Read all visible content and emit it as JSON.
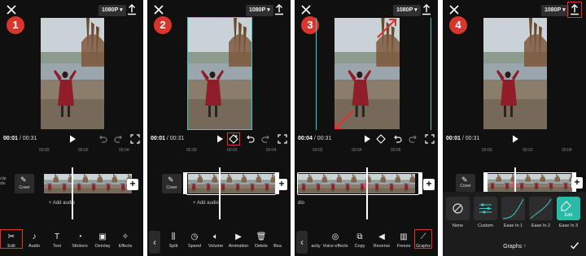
{
  "panels": [
    {
      "step": "1",
      "resolution": "1080P",
      "time_current": "00:01",
      "time_total": "/ 00:31",
      "ruler": [
        "00:00",
        "00:02",
        "00:04"
      ],
      "clip_sound_line1": "clip",
      "clip_sound_line2": "dio",
      "cover_label": "Cover",
      "add_audio": "+ Add audio",
      "tools": [
        {
          "icon": "scissors-icon",
          "label": "Edit",
          "boxed": true
        },
        {
          "icon": "music-note-icon",
          "label": "Audio"
        },
        {
          "icon": "text-icon",
          "label": "Text"
        },
        {
          "icon": "sticker-icon",
          "label": "Stickers"
        },
        {
          "icon": "overlay-icon",
          "label": "Overlay"
        },
        {
          "icon": "effects-icon",
          "label": "Effects"
        }
      ]
    },
    {
      "step": "2",
      "resolution": "1080P",
      "time_current": "00:01",
      "time_total": "/ 00:31",
      "ruler": [
        "00:00",
        "00:02",
        "00:04"
      ],
      "cover_label": "Cover",
      "add_audio": "+ Add audio",
      "tools": [
        {
          "icon": "split-icon",
          "label": "Split"
        },
        {
          "icon": "speed-icon",
          "label": "Speed"
        },
        {
          "icon": "volume-icon",
          "label": "Volume"
        },
        {
          "icon": "animation-icon",
          "label": "Animation"
        },
        {
          "icon": "delete-icon",
          "label": "Delete"
        },
        {
          "icon": "more-icon",
          "label": "Bea"
        }
      ]
    },
    {
      "step": "3",
      "resolution": "1080P",
      "time_current": "00:04",
      "time_total": "/ 00:31",
      "ruler": [
        "00:02",
        "00:04",
        "00:06"
      ],
      "audio_label": "dio",
      "tools": [
        {
          "icon": "opacity-icon",
          "label": "acity"
        },
        {
          "icon": "voice-effects-icon",
          "label": "Voice effects"
        },
        {
          "icon": "copy-icon",
          "label": "Copy"
        },
        {
          "icon": "reverse-icon",
          "label": "Reverse"
        },
        {
          "icon": "freeze-icon",
          "label": "Freeze"
        },
        {
          "icon": "graphs-icon",
          "label": "Graphs",
          "boxed": true
        }
      ]
    },
    {
      "step": "4",
      "resolution": "1080P",
      "time_current": "00:01",
      "time_total": "/ 00:31",
      "ruler": [
        "00:00",
        "00:02",
        "00:04"
      ],
      "cover_label": "Cover",
      "graph_options": [
        {
          "icon": "none-icon",
          "label": "None"
        },
        {
          "icon": "custom-icon",
          "label": "Custom"
        },
        {
          "icon": "ease-curve-icon",
          "label": "Ease In 1"
        },
        {
          "icon": "ease-curve-icon",
          "label": "Ease In 2"
        },
        {
          "icon": "edit-icon",
          "label": "Ease In 3",
          "active": true,
          "overlay_label": "Edit"
        }
      ],
      "sheet_title": "Graphs",
      "sheet_help": "?"
    }
  ],
  "colors": {
    "badge": "#d8362c",
    "highlight_box": "#e0312e",
    "selection_teal": "#3ec9c2",
    "keyframe": "#e84a5f",
    "active_option": "#2cbaa8"
  }
}
